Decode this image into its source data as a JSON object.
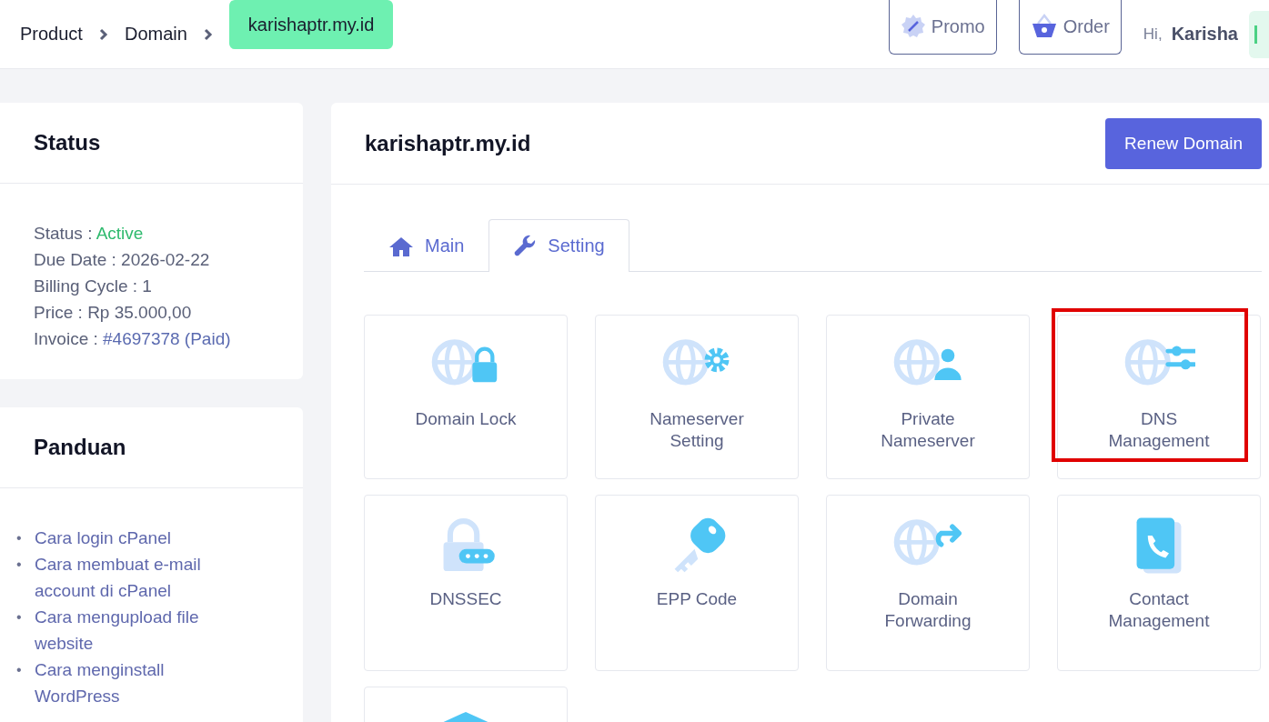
{
  "breadcrumb": [
    {
      "label": "Product",
      "selected": false
    },
    {
      "label": "Domain",
      "selected": false
    },
    {
      "label": "karishaptr.my.id",
      "selected": true
    }
  ],
  "header": {
    "buttons": [
      {
        "label": "Promo",
        "kind": "promo"
      },
      {
        "label": "Order",
        "kind": "order"
      }
    ],
    "greeting": "Hi,",
    "user": "Karisha"
  },
  "status_card": {
    "title": "Status",
    "fields": [
      {
        "label": "Status :",
        "value": "Active",
        "kind": "status"
      },
      {
        "label": "Due Date :",
        "value": "2026-02-22",
        "kind": "plain"
      },
      {
        "label": "Billing Cycle :",
        "value": "1",
        "kind": "plain"
      },
      {
        "label": "Price :",
        "value": "Rp 35.000,00",
        "kind": "plain"
      },
      {
        "label": "Invoice :",
        "value": "#4697378 (Paid)",
        "kind": "link"
      }
    ]
  },
  "guide_card": {
    "title": "Panduan",
    "links": [
      {
        "marker": "•",
        "text": "Cara login cPanel"
      },
      {
        "marker": "•",
        "text": "Cara membuat e-mail account di cPanel"
      },
      {
        "marker": "•",
        "text": "Cara mengupload file website"
      },
      {
        "marker": "•",
        "text": "Cara menginstall WordPress"
      }
    ]
  },
  "main": {
    "title": "karishaptr.my.id",
    "renew_button": "Renew Domain",
    "tabs": [
      {
        "label": "Main",
        "kind": "home",
        "selected": false
      },
      {
        "label": "Setting",
        "kind": "wrench",
        "selected": true
      }
    ],
    "tiles": [
      {
        "label": "Domain Lock",
        "kind": "lock",
        "highlighted": false
      },
      {
        "label": "Nameserver Setting",
        "kind": "gear",
        "highlighted": false
      },
      {
        "label": "Private Nameserver",
        "kind": "person",
        "highlighted": false
      },
      {
        "label": "DNS Management",
        "kind": "sliders",
        "highlighted": true
      },
      {
        "label": "DNSSEC",
        "kind": "dnssec",
        "highlighted": false
      },
      {
        "label": "EPP Code",
        "kind": "key",
        "highlighted": false
      },
      {
        "label": "Domain Forwarding",
        "kind": "forward",
        "highlighted": false
      },
      {
        "label": "Contact Management",
        "kind": "phone",
        "highlighted": false
      },
      {
        "kind": "shield",
        "highlighted": false
      }
    ]
  }
}
